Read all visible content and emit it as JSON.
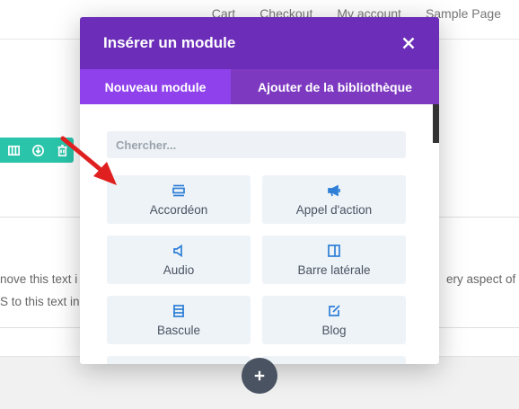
{
  "nav": {
    "items": [
      "Cart",
      "Checkout",
      "My account",
      "Sample Page"
    ]
  },
  "background": {
    "text_line_1_left": "nove this text i",
    "text_line_1_right": "ery aspect of t",
    "text_line_2_left": "S to this text in"
  },
  "modal": {
    "title": "Insérer un module",
    "tabs": [
      {
        "label": "Nouveau module"
      },
      {
        "label": "Ajouter de la bibliothèque"
      }
    ],
    "search_placeholder": "Chercher...",
    "modules": [
      {
        "label": "Accordéon",
        "icon": "accordion-icon"
      },
      {
        "label": "Appel d'action",
        "icon": "megaphone-icon"
      },
      {
        "label": "Audio",
        "icon": "speaker-icon"
      },
      {
        "label": "Barre latérale",
        "icon": "sidebar-icon"
      },
      {
        "label": "Bascule",
        "icon": "toggle-icon"
      },
      {
        "label": "Blog",
        "icon": "blog-icon"
      }
    ]
  },
  "colors": {
    "header": "#6c2eb9",
    "tab_active": "#8f42ec",
    "tile_bg": "#eef3f8",
    "icon": "#2e7fd6",
    "toolbar": "#29c4a9",
    "arrow": "#e02020"
  }
}
